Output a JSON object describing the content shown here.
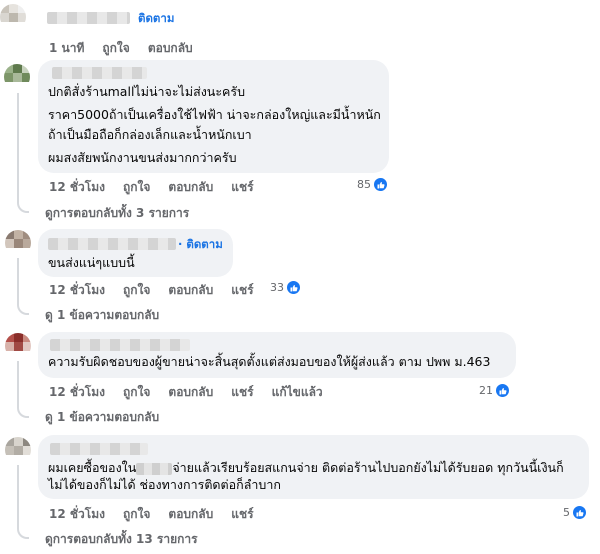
{
  "comments": [
    {
      "follow": "ติดตาม",
      "lines": [],
      "actions": [
        "1 นาที",
        "ถูกใจ",
        "ตอบกลับ"
      ],
      "reactions": null,
      "replies": null
    },
    {
      "follow": null,
      "lines": [
        "ปกติสั่งร้านmallไม่น่าจะไม่ส่งนะครับ",
        "ราคา5000ถ้าเป็นเครื่องใช้ไฟฟ้า น่าจะกล่องใหญ่และมีน้ำหนัก",
        "ถ้าเป็นมือถือก็กล่องเล็กและน้ำหนักเบา",
        "ผมสงสัยพนักงานขนส่งมากกว่าครับ"
      ],
      "actions": [
        "12 ชั่วโมง",
        "ถูกใจ",
        "ตอบกลับ",
        "แชร์"
      ],
      "reactions": "85",
      "replies": "ดูการตอบกลับทั้ง 3 รายการ"
    },
    {
      "follow": "· ติดตาม",
      "lines": [
        "ขนส่งแน่ๆแบบนี้"
      ],
      "actions": [
        "12 ชั่วโมง",
        "ถูกใจ",
        "ตอบกลับ",
        "แชร์"
      ],
      "reactions": "33",
      "replies": "ดู 1 ข้อความตอบกลับ"
    },
    {
      "follow": null,
      "lines": [
        "ความรับผิดชอบของผู้ขายน่าจะสิ้นสุดตั้งแต่ส่งมอบของให้ผู้ส่งแล้ว ตาม ปพพ ม.463"
      ],
      "actions": [
        "12 ชั่วโมง",
        "ถูกใจ",
        "ตอบกลับ",
        "แชร์",
        "แก้ไขแล้ว"
      ],
      "reactions": "21",
      "replies": "ดู 1 ข้อความตอบกลับ"
    },
    {
      "follow": null,
      "lines": [
        "ผมเคยซื้อของใน",
        "จ่ายแล้วเรียบร้อยสแกนจ่าย ติดต่อร้านไปบอกยังไม่ได้รับยอด ทุกวันนี้เงินก็",
        "ไม่ได้ของก็ไม่ได้ ช่องทางการติดต่อก็ลำบาก"
      ],
      "actions": [
        "12 ชั่วโมง",
        "ถูกใจ",
        "ตอบกลับ",
        "แชร์"
      ],
      "reactions": "5",
      "replies": "ดูการตอบกลับทั้ง 13 รายการ"
    }
  ],
  "colors": {
    "accent": "#1b74e4",
    "bubble": "#f0f2f5",
    "muted": "#65676b",
    "like": "#1877f2"
  }
}
